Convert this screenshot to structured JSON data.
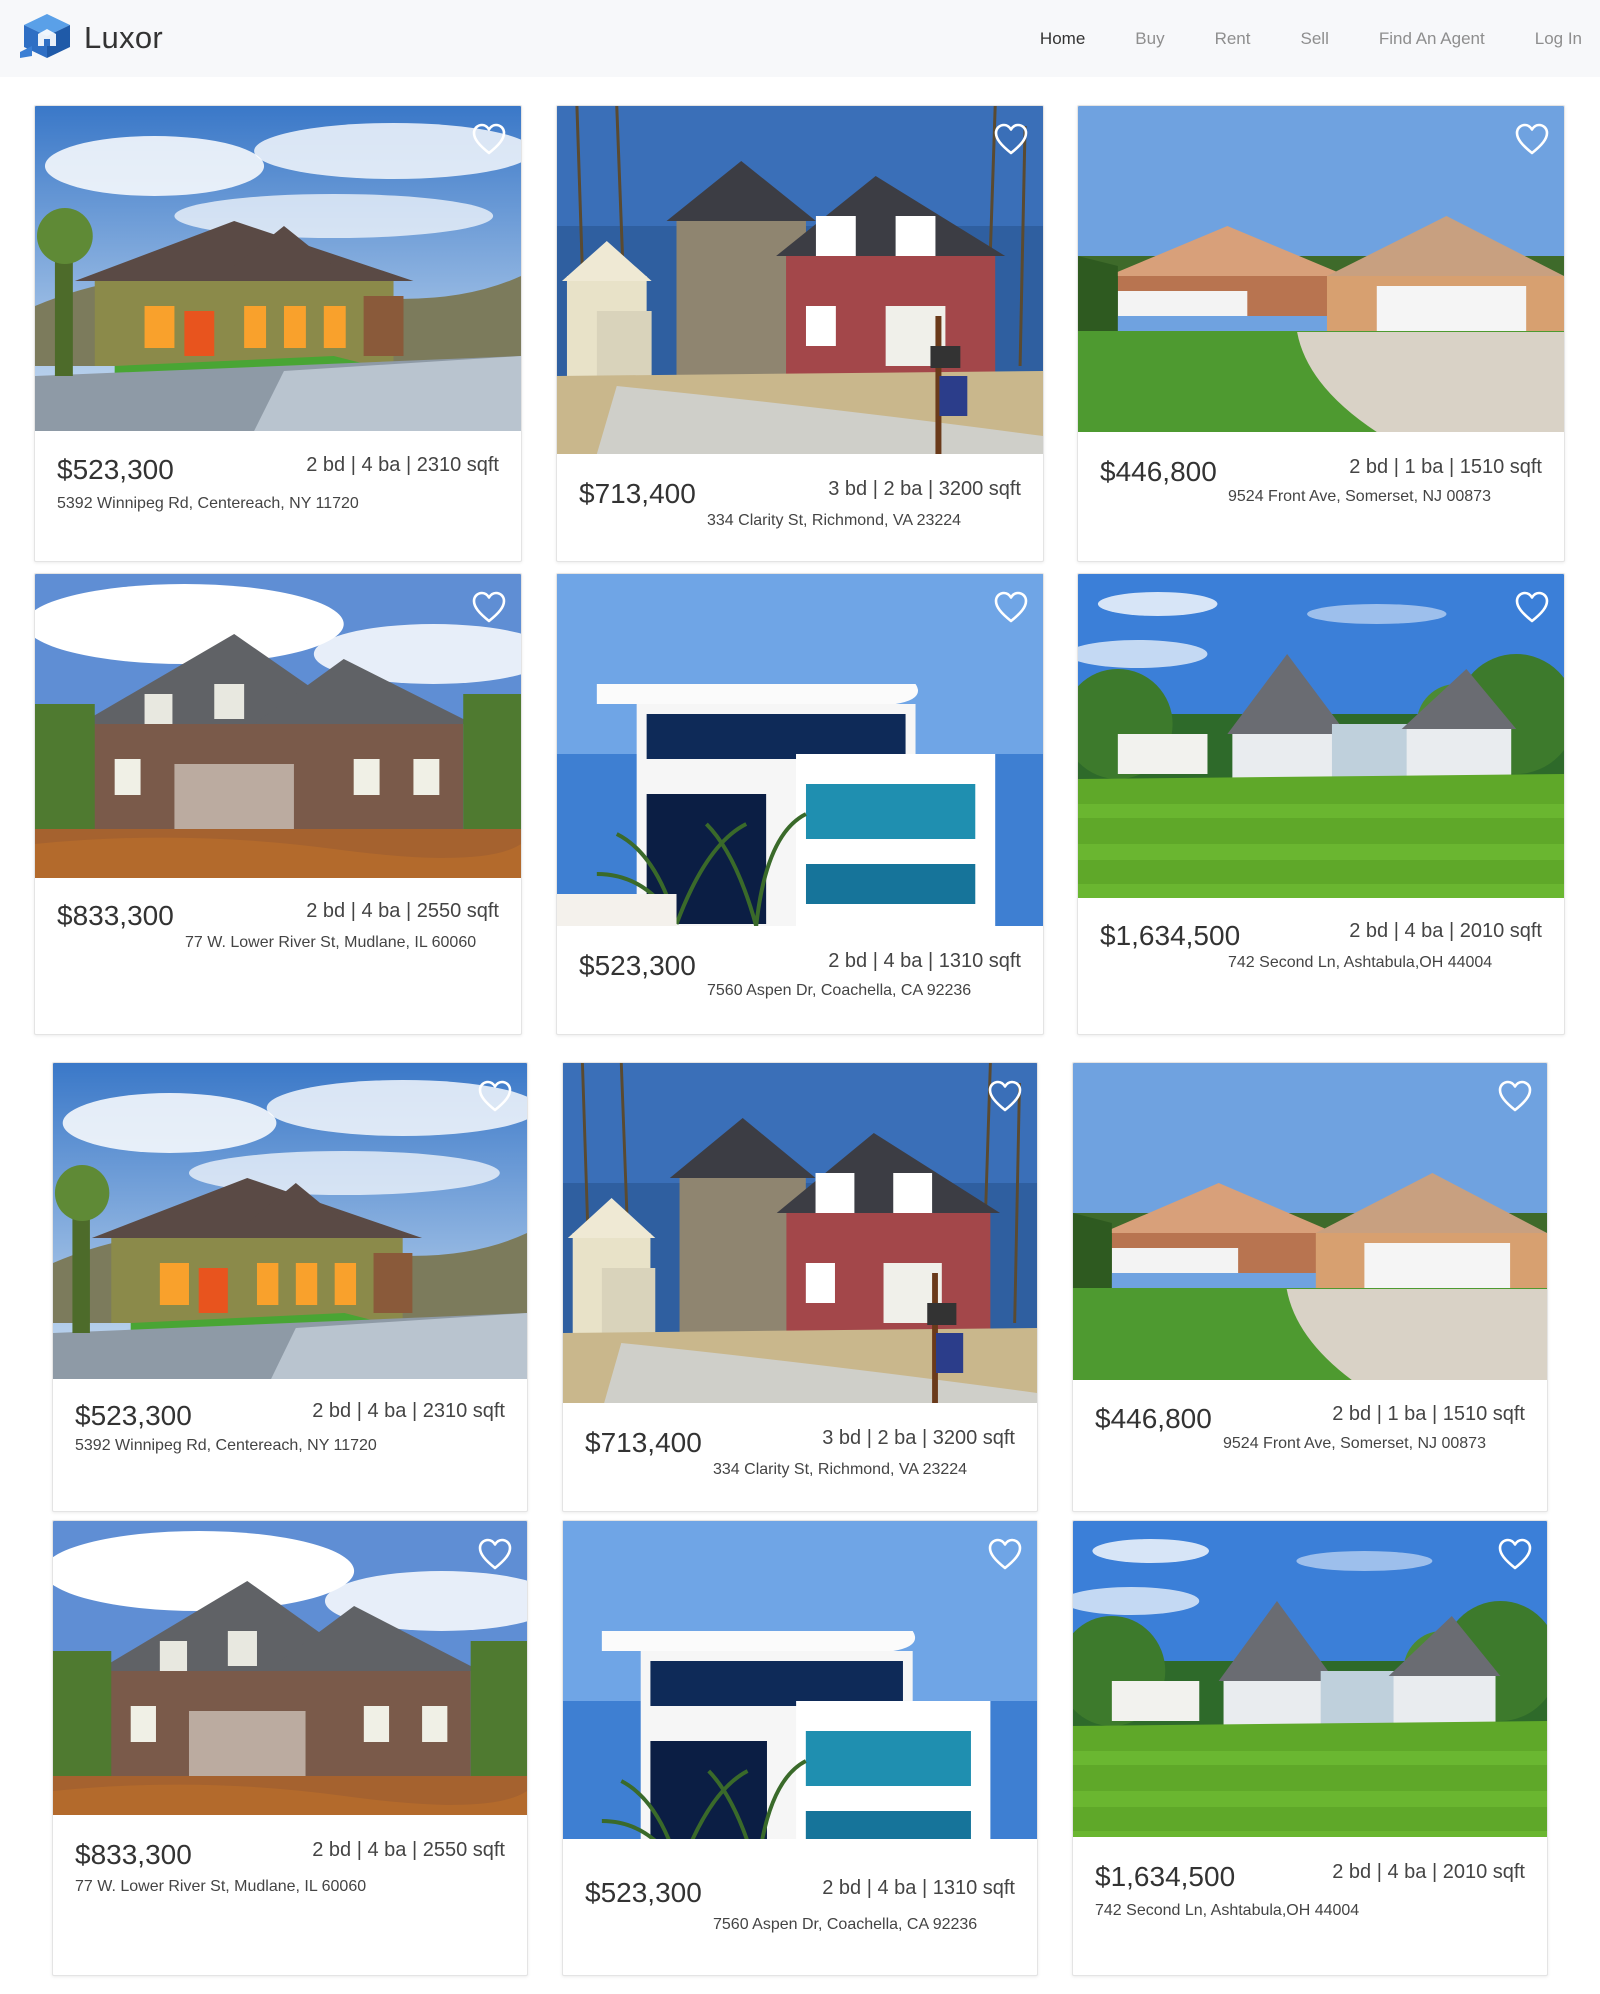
{
  "brand": {
    "name": "Luxor",
    "logo_icon": "house-cube-icon"
  },
  "nav": {
    "items": [
      "Home",
      "Buy",
      "Rent",
      "Sell",
      "Find An Agent",
      "Log In"
    ],
    "active": "Home"
  },
  "colors": {
    "header_bg": "#f7f8fa",
    "logo_blue": "#3b7fd4",
    "text": "#333333",
    "nav_inactive": "#8e8e8e"
  },
  "listings": [
    {
      "price": "$523,300",
      "specs": "2 bd | 4 ba | 2310 sqft",
      "address": "5392 Winnipeg Rd, Centereach, NY 11720",
      "photo": "craftsman-house-photo"
    },
    {
      "price": "$713,400",
      "specs": "3 bd | 2 ba | 3200 sqft",
      "address": "334 Clarity St, Richmond, VA 23224",
      "photo": "colonial-house-photo"
    },
    {
      "price": "$446,800",
      "specs": "2 bd | 1 ba | 1510 sqft",
      "address": "9524 Front Ave, Somerset, NJ 00873",
      "photo": "ranch-house-photo"
    },
    {
      "price": "$833,300",
      "specs": "2 bd | 4 ba | 2550 sqft",
      "address": "77 W. Lower River St, Mudlane, IL 60060",
      "photo": "brick-house-photo"
    },
    {
      "price": "$523,300",
      "specs": "2 bd | 4 ba | 1310 sqft",
      "address": "7560 Aspen Dr, Coachella, CA 92236",
      "photo": "modern-house-photo"
    },
    {
      "price": "$1,634,500",
      "specs": "2 bd | 4 ba | 2010 sqft",
      "address": "742 Second Ln, Ashtabula,OH 44004",
      "photo": "farmhouse-photo"
    },
    {
      "price": "$523,300",
      "specs": "2 bd | 4 ba | 2310 sqft",
      "address": "5392 Winnipeg Rd, Centereach, NY 11720",
      "photo": "craftsman-house-photo"
    },
    {
      "price": "$713,400",
      "specs": "3 bd | 2 ba | 3200 sqft",
      "address": "334 Clarity St, Richmond, VA 23224",
      "photo": "colonial-house-photo"
    },
    {
      "price": "$446,800",
      "specs": "2 bd | 1 ba | 1510 sqft",
      "address": "9524 Front Ave, Somerset, NJ 00873",
      "photo": "ranch-house-photo"
    },
    {
      "price": "$833,300",
      "specs": "2 bd | 4 ba | 2550 sqft",
      "address": "77 W. Lower River St, Mudlane, IL 60060",
      "photo": "brick-house-photo"
    },
    {
      "price": "$523,300",
      "specs": "2 bd | 4 ba | 1310 sqft",
      "address": "7560 Aspen Dr, Coachella, CA 92236",
      "photo": "modern-house-photo"
    },
    {
      "price": "$1,634,500",
      "specs": "2 bd | 4 ba | 2010 sqft",
      "address": "742 Second Ln, Ashtabula,OH 44004",
      "photo": "farmhouse-photo"
    }
  ]
}
